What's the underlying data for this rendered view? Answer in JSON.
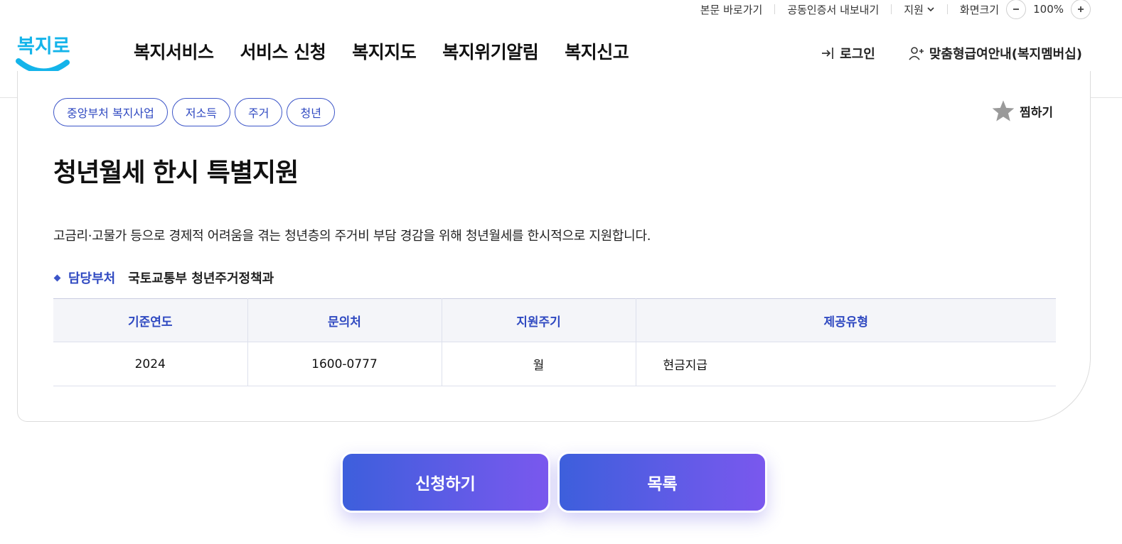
{
  "utility": {
    "skip_to_content": "본문 바로가기",
    "export_cert": "공동인증서 내보내기",
    "language": "지원",
    "zoom_label": "화면크기",
    "zoom_value": "100%"
  },
  "header": {
    "logo_text": "복지로",
    "nav": [
      "복지서비스",
      "서비스 신청",
      "복지지도",
      "복지위기알림",
      "복지신고"
    ],
    "login": "로그인",
    "membership": "맞춤형급여안내(복지멤버십)"
  },
  "detail": {
    "tags": [
      "중앙부처 복지사업",
      "저소득",
      "주거",
      "청년"
    ],
    "favorite": "찜하기",
    "title": "청년월세 한시 특별지원",
    "description": "고금리·고물가 등으로 경제적 어려움을 겪는 청년층의 주거비 부담 경감을 위해 청년월세를 한시적으로 지원합니다.",
    "dept_label": "담당부처",
    "dept_value": "국토교통부 청년주거정책과",
    "table": {
      "headers": [
        "기준연도",
        "문의처",
        "지원주기",
        "제공유형"
      ],
      "row": [
        "2024",
        "1600-0777",
        "월",
        "현금지급"
      ]
    }
  },
  "actions": {
    "apply": "신청하기",
    "list": "목록"
  },
  "colors": {
    "brand_blue": "#2f49c1",
    "gradient_start": "#3d5fdc",
    "gradient_end": "#7a58ee",
    "logo_cyan": "#14b4ea"
  },
  "icons": {
    "login": "login-arrow-icon",
    "membership": "user-plus-icon",
    "favorite": "star-icon",
    "language": "chevron-down-icon",
    "zoom_out": "minus-icon",
    "zoom_in": "plus-icon"
  }
}
